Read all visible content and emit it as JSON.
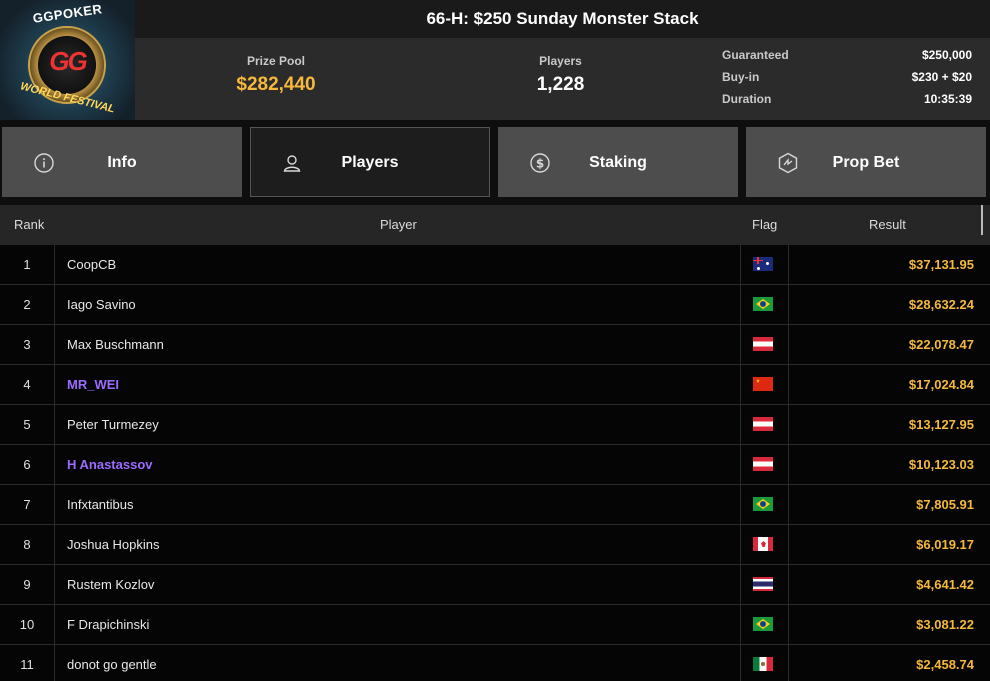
{
  "logo": {
    "top_text": "GGPOKER",
    "bottom_text": "WORLD FESTIVAL",
    "mark": "GG"
  },
  "title": "66-H: $250 Sunday Monster Stack",
  "stats": {
    "prize_pool": {
      "label": "Prize Pool",
      "value": "$282,440"
    },
    "players": {
      "label": "Players",
      "value": "1,228"
    },
    "details": [
      {
        "key": "Guaranteed",
        "value": "$250,000"
      },
      {
        "key": "Buy-in",
        "value": "$230 + $20"
      },
      {
        "key": "Duration",
        "value": "10:35:39"
      }
    ]
  },
  "tabs": [
    {
      "label": "Info",
      "icon": "info-icon",
      "active": false
    },
    {
      "label": "Players",
      "icon": "user-icon",
      "active": true
    },
    {
      "label": "Staking",
      "icon": "dollar-coin-icon",
      "active": false
    },
    {
      "label": "Prop Bet",
      "icon": "prop-bet-icon",
      "active": false
    }
  ],
  "table": {
    "headers": {
      "rank": "Rank",
      "player": "Player",
      "flag": "Flag",
      "result": "Result"
    },
    "rows": [
      {
        "rank": "1",
        "player": "CoopCB",
        "flag": "au",
        "result": "$37,131.95",
        "highlight": false
      },
      {
        "rank": "2",
        "player": "Iago Savino",
        "flag": "br",
        "result": "$28,632.24",
        "highlight": false
      },
      {
        "rank": "3",
        "player": "Max Buschmann",
        "flag": "at",
        "result": "$22,078.47",
        "highlight": false
      },
      {
        "rank": "4",
        "player": "MR_WEI",
        "flag": "cn",
        "result": "$17,024.84",
        "highlight": true
      },
      {
        "rank": "5",
        "player": "Peter Turmezey",
        "flag": "at",
        "result": "$13,127.95",
        "highlight": false
      },
      {
        "rank": "6",
        "player": "H Anastassov",
        "flag": "at",
        "result": "$10,123.03",
        "highlight": true
      },
      {
        "rank": "7",
        "player": "Infxtantibus",
        "flag": "br",
        "result": "$7,805.91",
        "highlight": false
      },
      {
        "rank": "8",
        "player": "Joshua Hopkins",
        "flag": "ca",
        "result": "$6,019.17",
        "highlight": false
      },
      {
        "rank": "9",
        "player": "Rustem Kozlov",
        "flag": "th",
        "result": "$4,641.42",
        "highlight": false
      },
      {
        "rank": "10",
        "player": "F Drapichinski",
        "flag": "br",
        "result": "$3,081.22",
        "highlight": false
      },
      {
        "rank": "11",
        "player": "donot go gentle",
        "flag": "mx",
        "result": "$2,458.74",
        "highlight": false
      }
    ]
  },
  "colors": {
    "accent_gold": "#f6b93b",
    "staked_purple": "#9b6cff"
  }
}
